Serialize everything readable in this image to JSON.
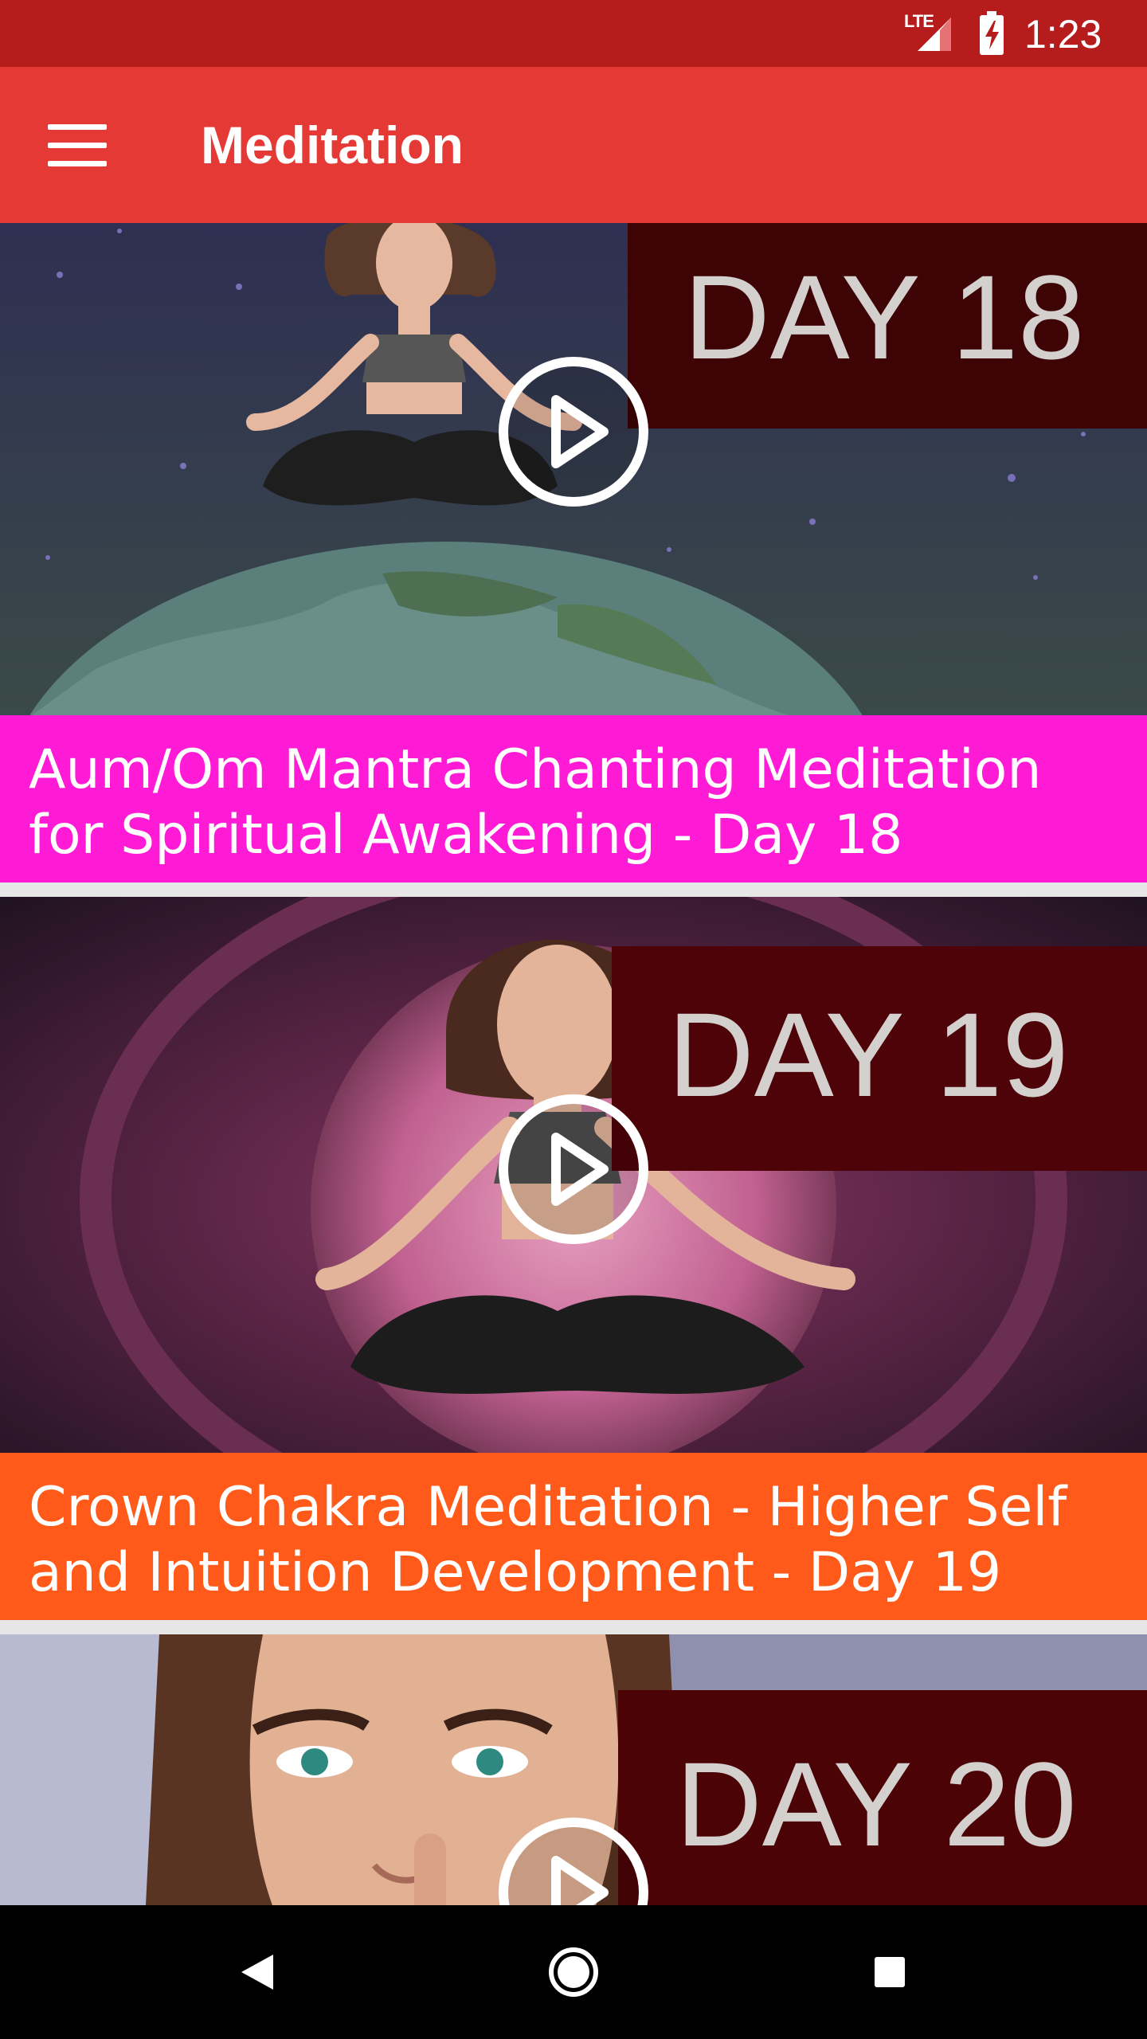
{
  "status_bar": {
    "network": "LTE",
    "time": "1:23"
  },
  "app_bar": {
    "title": "Meditation",
    "menu_icon": "hamburger-menu-icon"
  },
  "videos": [
    {
      "day_label": "DAY 18",
      "title": "Aum/Om Mantra Chanting Meditation for Spiritual Awakening - Day 18",
      "caption_color": "#ff1ad6"
    },
    {
      "day_label": "DAY 19",
      "title": "Crown Chakra Meditation - Higher Self and Intuition Development - Day 19",
      "caption_color": "#ff5a1a"
    },
    {
      "day_label": "DAY 20",
      "title": "",
      "caption_color": ""
    }
  ],
  "nav_bar": {
    "back_icon": "back-triangle-icon",
    "home_icon": "home-circle-icon",
    "recents_icon": "recents-square-icon"
  },
  "colors": {
    "status_bar": "#b71c1c",
    "app_bar": "#e53935"
  }
}
